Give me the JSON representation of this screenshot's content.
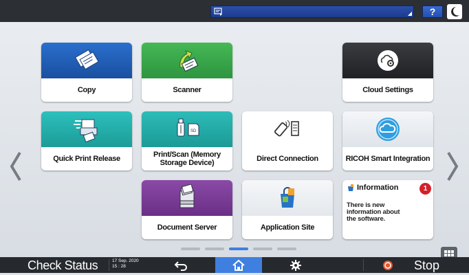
{
  "top_bar": {
    "help_label": "?"
  },
  "tiles": {
    "copy": "Copy",
    "scanner": "Scanner",
    "cloud_settings": "Cloud Settings",
    "quick_print_release": "Quick Print Release",
    "print_scan_memory": "Print/Scan (Memory Storage Device)",
    "direct_connection": "Direct Connection",
    "ricoh_smart_integration": "RICOH Smart Integration",
    "document_server": "Document Server",
    "application_site": "Application Site"
  },
  "information": {
    "title": "Information",
    "badge_count": "1",
    "message": "There is new information about the software."
  },
  "pager": {
    "page_count": 5,
    "active_index": 2
  },
  "bottom_bar": {
    "check_status": "Check Status",
    "date": "17 Sep. 2020",
    "time": "15 : 28",
    "stop": "Stop"
  },
  "colors": {
    "copy_band": "#1f5fb8",
    "scanner_band": "#3aa64a",
    "cloud_band": "#2b2d30",
    "quick_print_band": "#22b0ad",
    "print_scan_band": "#25a8a6",
    "document_server_band": "#7b3f96",
    "active_accent": "#3f7fe0",
    "info_badge": "#d3212a"
  }
}
